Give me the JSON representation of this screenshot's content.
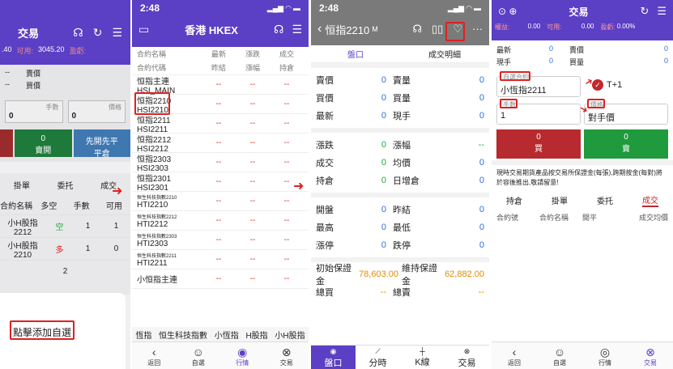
{
  "panel1": {
    "title": "交易",
    "stat_left": ".40",
    "stat_avail_label": "可用:",
    "stat_avail": "3045.20",
    "stat_pl_label": "盈虧:",
    "row_a": [
      "--",
      "賣價"
    ],
    "row_b": [
      "--",
      "買價"
    ],
    "qty_label": "手數",
    "price_label": "價格",
    "qty_value": "0",
    "price_value": "0",
    "buy_open_value": "0",
    "buy_open_label": "賣開",
    "close_first_label": "先開先平",
    "close_first_sub": "平倉",
    "tabs": [
      "掛單",
      "委托",
      "成交"
    ],
    "cols": [
      "合約名稱",
      "多空",
      "手數",
      "可用"
    ],
    "rows": [
      [
        "小H股指2212",
        "空",
        "1",
        "1"
      ],
      [
        "小H股指2210",
        "多",
        "1",
        "0"
      ]
    ],
    "count": "2",
    "add_favorite": "點擊添加自選"
  },
  "panel2": {
    "time": "2:48",
    "title": "香港 HKEX",
    "header1": [
      "合約名稱",
      "最新",
      "漲跌",
      "成交"
    ],
    "header2": [
      "合約代碼",
      "昨結",
      "漲幅",
      "持倉"
    ],
    "items": [
      {
        "name": "恒指主連",
        "code": "HSI_MAIN"
      },
      {
        "name": "恒指2210",
        "code": "HSI2210"
      },
      {
        "name": "恒指2211",
        "code": "HSI2211"
      },
      {
        "name": "恒指2212",
        "code": "HSI2212"
      },
      {
        "name": "恒指2303",
        "code": "HSI2303"
      },
      {
        "name": "恒指2301",
        "code": "HSI2301"
      },
      {
        "name": "恒生科技指數2210",
        "code": "HTI2210"
      },
      {
        "name": "恒生科技指數2212",
        "code": "HTI2212"
      },
      {
        "name": "恒生科技指數2303",
        "code": "HTI2303"
      },
      {
        "name": "恒生科技指數2211",
        "code": "HTI2211"
      },
      {
        "name": "小恒指主連",
        "code": ""
      }
    ],
    "dash": "--",
    "cats": [
      "恆指",
      "恒生科技指數",
      "小恆指",
      "H股指",
      "小H股指"
    ],
    "tabs": [
      "返回",
      "自選",
      "行情",
      "交易"
    ]
  },
  "panel3": {
    "time": "2:48",
    "title": "恒指2210",
    "badge": "M",
    "tabs": [
      "盤口",
      "成交明細"
    ],
    "rows1": [
      [
        "賣價",
        "0",
        "賣量",
        "0"
      ],
      [
        "買價",
        "0",
        "買量",
        "0"
      ],
      [
        "最新",
        "0",
        "現手",
        "0"
      ]
    ],
    "rows2": [
      [
        "漲跌",
        "0",
        "漲幅",
        "--"
      ],
      [
        "成交",
        "0",
        "均價",
        "0"
      ],
      [
        "持倉",
        "0",
        "日增倉",
        "0"
      ]
    ],
    "rows3": [
      [
        "開盤",
        "0",
        "昨結",
        "0"
      ],
      [
        "最高",
        "0",
        "最低",
        "0"
      ],
      [
        "漲停",
        "0",
        "跌停",
        "0"
      ]
    ],
    "margin_init_label": "初始保證金",
    "margin_init": "78,603.00",
    "margin_maint_label": "維持保證金",
    "margin_maint": "62,882.00",
    "total_buy": "總買",
    "total_sell": "總賣",
    "dash": "--",
    "bottom": [
      "盤口",
      "分時",
      "K線",
      "交易"
    ]
  },
  "panel4": {
    "title": "交易",
    "rights_label": "權益:",
    "rights": "0.00",
    "avail_label": "可用:",
    "avail": "0.00",
    "pl_label": "盈虧:",
    "pl": "0.00%",
    "quote": [
      [
        "最新",
        "0",
        "賣價",
        "0"
      ],
      [
        "現手",
        "0",
        "買量",
        "0"
      ]
    ],
    "contract_label": "自選合約",
    "contract": "小恆指2211",
    "tplus": "T+1",
    "qty_label": "手數",
    "qty": "1",
    "price_label": "價格",
    "price": "對手價",
    "buy_value": "0",
    "buy_label": "買",
    "sell_value": "0",
    "sell_label": "賣",
    "notice": "現時交易期貨產品按交易所保證金(每張),跨期按金(每對)將於容後推出,敬請留意!",
    "tabs": [
      "持倉",
      "掛單",
      "委托",
      "成交"
    ],
    "cols": [
      "合約號",
      "合約名稱",
      "開平",
      "成交均價"
    ],
    "bottom": [
      "返回",
      "自選",
      "行情",
      "交易"
    ]
  }
}
